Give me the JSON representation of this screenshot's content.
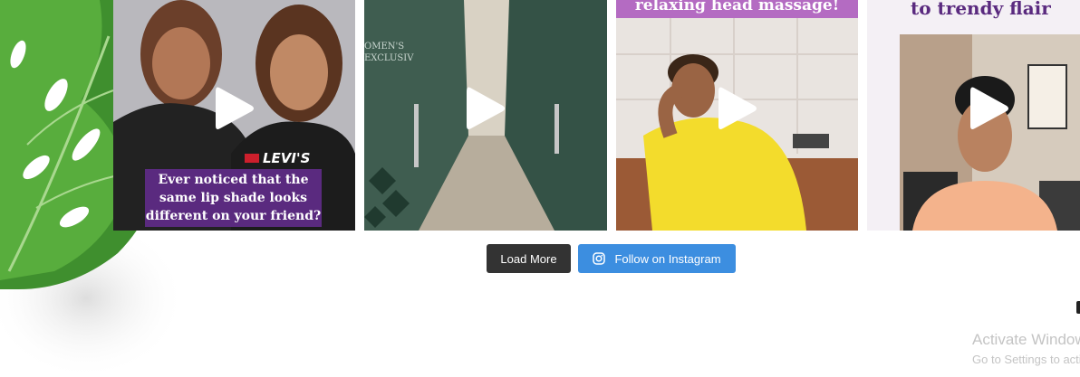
{
  "feed": {
    "tiles": [
      {
        "caption": "Ever noticed that the same lip shade looks different on your friend?",
        "shirt_text": "LEVI'S",
        "icon": "play-icon"
      },
      {
        "caption": "",
        "wall_text": "OMEN'S EXCLUSIVE",
        "icon": "play-icon"
      },
      {
        "caption": "relaxing head massage!",
        "icon": "play-icon"
      },
      {
        "caption": "to trendy flair",
        "icon": "play-icon"
      }
    ],
    "load_more_label": "Load More",
    "follow_label": "Follow on Instagram",
    "follow_icon": "instagram-icon"
  },
  "os_watermark": {
    "title": "Activate Windows",
    "subtitle": "Go to Settings to activate Windows."
  },
  "colors": {
    "load_more_bg": "#333333",
    "follow_bg": "#3c8ee0",
    "caption_purple": "#5a2a7f"
  }
}
